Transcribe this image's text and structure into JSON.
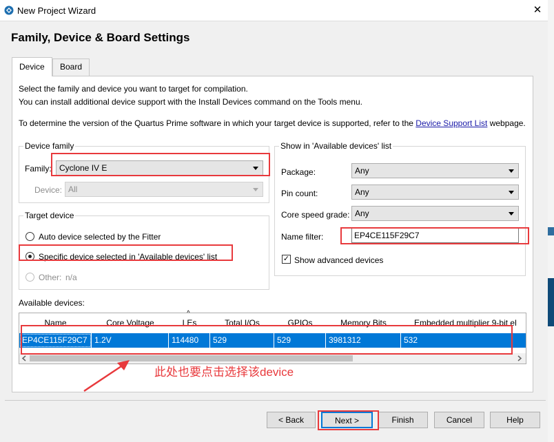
{
  "window": {
    "title": "New Project Wizard",
    "close_glyph": "✕"
  },
  "page_title": "Family, Device & Board Settings",
  "tabs": [
    {
      "label": "Device"
    },
    {
      "label": "Board"
    }
  ],
  "intro": {
    "line1": "Select the family and device you want to target for compilation.",
    "line2": "You can install additional device support with the Install Devices command on the Tools menu.",
    "line3_prefix": "To determine the version of the Quartus Prime software in which your target device is supported, refer to the",
    "line3_link": "Device Support List",
    "line3_suffix": "webpage."
  },
  "device_family": {
    "group_label": "Device family",
    "family_label": "Family:",
    "family_value": "Cyclone IV E",
    "device_label": "Device:",
    "device_value": "All"
  },
  "show_in_list": {
    "group_label": "Show in 'Available devices' list",
    "package_label": "Package:",
    "package_value": "Any",
    "pincount_label": "Pin count:",
    "pincount_value": "Any",
    "speed_label": "Core speed grade:",
    "speed_value": "Any",
    "namefilter_label": "Name filter:",
    "namefilter_value": "EP4CE115F29C7",
    "advanced_label": "Show advanced devices",
    "advanced_checked": true
  },
  "target_device": {
    "group_label": "Target device",
    "auto_label": "Auto device selected by the Fitter",
    "specific_label": "Specific device selected in 'Available devices' list",
    "other_label": "Other:",
    "other_value": "n/a",
    "selected": "specific"
  },
  "available_devices": {
    "label": "Available devices:",
    "columns": [
      "Name",
      "Core Voltage",
      "LEs",
      "Total I/Os",
      "GPIOs",
      "Memory Bits",
      "Embedded multiplier 9-bit el"
    ],
    "sort_glyph": "^",
    "rows": [
      [
        "EP4CE115F29C7",
        "1.2V",
        "114480",
        "529",
        "529",
        "3981312",
        "532"
      ]
    ]
  },
  "annotation_text": "此处也要点击选择该device",
  "buttons": {
    "back": "< Back",
    "next": "Next >",
    "finish": "Finish",
    "cancel": "Cancel",
    "help": "Help"
  },
  "colors": {
    "highlight": "#0078d7",
    "annotation": "#e8393c",
    "link": "#1a1aa8"
  }
}
